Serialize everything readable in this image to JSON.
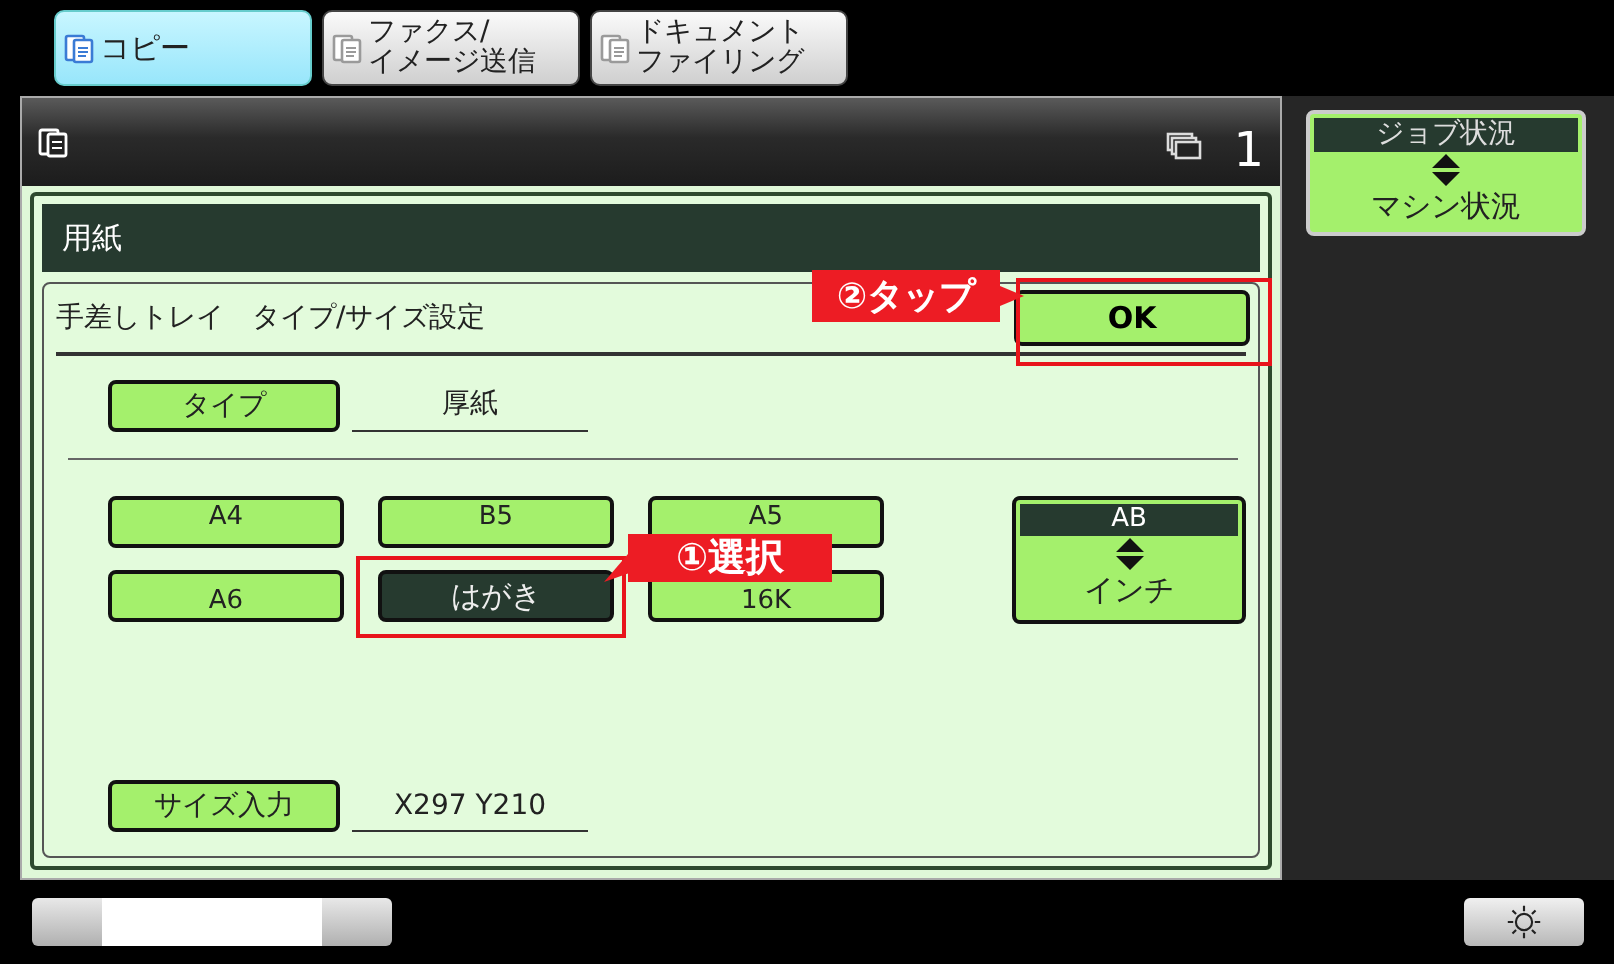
{
  "tabs": [
    {
      "lines": [
        "コピー"
      ],
      "kind": "copy",
      "selected": true
    },
    {
      "lines": [
        "ファクス/",
        "イメージ送信"
      ],
      "kind": "fax",
      "selected": false
    },
    {
      "lines": [
        "ドキュメント",
        "ファイリング"
      ],
      "kind": "document",
      "selected": false
    }
  ],
  "header": {
    "copies": "1"
  },
  "job_status": {
    "top": "ジョブ状況",
    "bottom": "マシン状況"
  },
  "dialog": {
    "title": "用紙",
    "subtitle": "手差しトレイ　タイプ/サイズ設定",
    "ok": "OK",
    "ok_callout": "②タップ",
    "type_button": "タイプ",
    "type_value": "厚紙",
    "sizes": [
      {
        "label": "A4",
        "selected": false
      },
      {
        "label": "B5",
        "selected": false
      },
      {
        "label": "A5",
        "selected": false
      },
      {
        "label": "A6",
        "selected": false
      },
      {
        "label": "はがき",
        "selected": true
      },
      {
        "label": "16K",
        "selected": false
      }
    ],
    "size_callout": "①選択",
    "unit_toggle": {
      "top": "AB",
      "bottom": "インチ"
    },
    "size_input_button": "サイズ入力",
    "size_input_value": "X297 Y210"
  }
}
